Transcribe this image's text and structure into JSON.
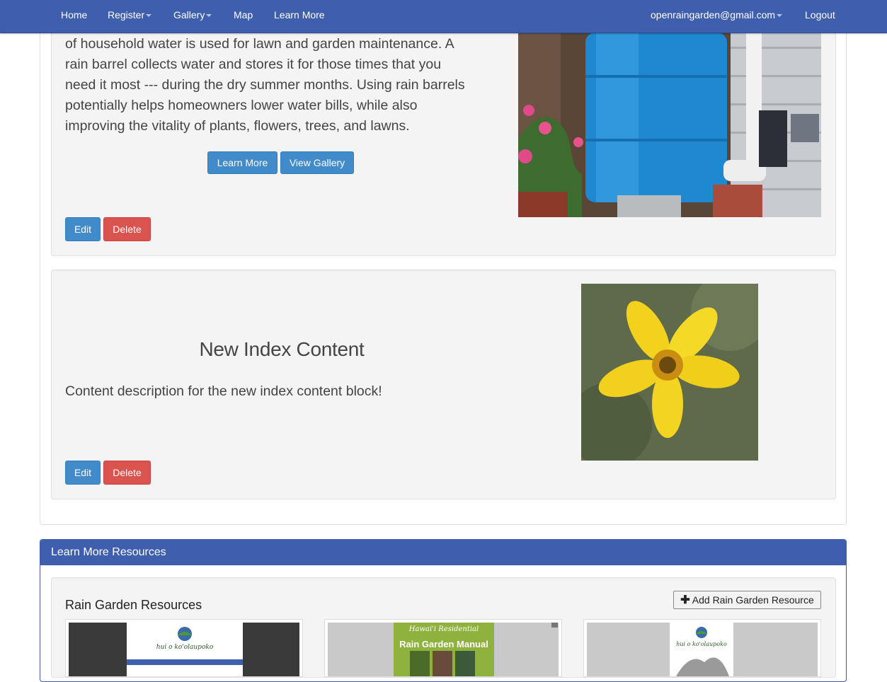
{
  "navbar": {
    "home": "Home",
    "register": "Register",
    "gallery": "Gallery",
    "map": "Map",
    "learn_more": "Learn More",
    "user_email": "openraingarden@gmail.com",
    "logout": "Logout"
  },
  "block1": {
    "lines": [
      "of household water is used for lawn and garden maintenance. A",
      "rain barrel collects water and stores it for those times that you",
      "need it most --- during the dry summer months. Using rain barrels",
      "potentially helps homeowners lower water bills, while also",
      "improving the vitality of plants, flowers, trees, and lawns."
    ],
    "learn_more_btn": "Learn More",
    "view_gallery_btn": "View Gallery",
    "edit_btn": "Edit",
    "delete_btn": "Delete"
  },
  "block2": {
    "title": "New Index Content",
    "description": "Content description for the new index content block!",
    "edit_btn": "Edit",
    "delete_btn": "Delete"
  },
  "resources": {
    "heading": "Learn More Resources",
    "section_title": "Rain Garden Resources",
    "add_button": "Add Rain Garden Resource",
    "thumb1_caption": "hui o ko'olaupoko",
    "thumb2_title_line1": "Hawai'i Residential",
    "thumb2_title_line2": "Rain Garden Manual",
    "thumb3_caption": "hui o ko'olaupoko"
  },
  "colors": {
    "navbar": "#3f5fae",
    "primary": "#428bca",
    "danger": "#d9534f"
  },
  "icons": {
    "add": "plus-icon"
  }
}
